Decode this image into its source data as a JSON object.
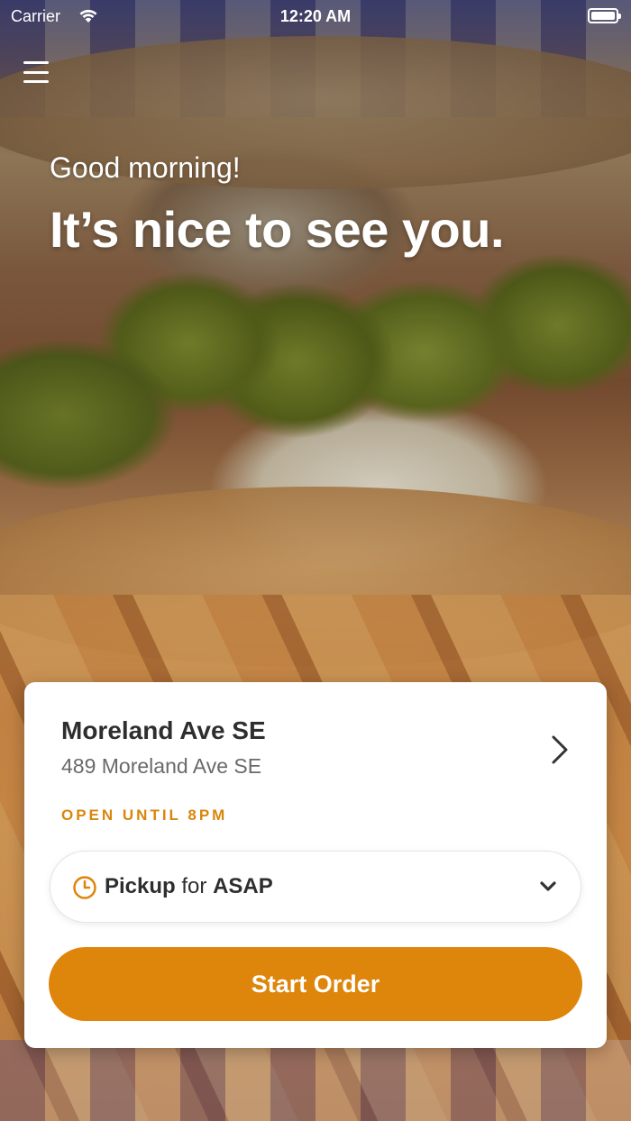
{
  "status_bar": {
    "carrier": "Carrier",
    "time": "12:20 AM",
    "wifi_icon": "wifi-icon",
    "battery_icon": "battery-full-icon"
  },
  "header": {
    "menu_icon": "hamburger-menu-icon"
  },
  "greeting": {
    "subtitle": "Good morning!",
    "headline": "It’s nice to see you."
  },
  "store_card": {
    "name": "Moreland Ave SE",
    "address": "489 Moreland Ave SE",
    "hours_status": "OPEN UNTIL 8PM",
    "chevron_icon": "chevron-right-icon",
    "order_mode": {
      "clock_icon": "clock-icon",
      "method": "Pickup",
      "connector": "for",
      "time": "ASAP",
      "dropdown_icon": "chevron-down-icon"
    },
    "start_button_label": "Start Order"
  },
  "colors": {
    "accent": "#de860b",
    "hours_text": "#d9860b",
    "card_bg": "#ffffff",
    "title_text": "#2e2e2e",
    "secondary_text": "#6a6a6a"
  }
}
